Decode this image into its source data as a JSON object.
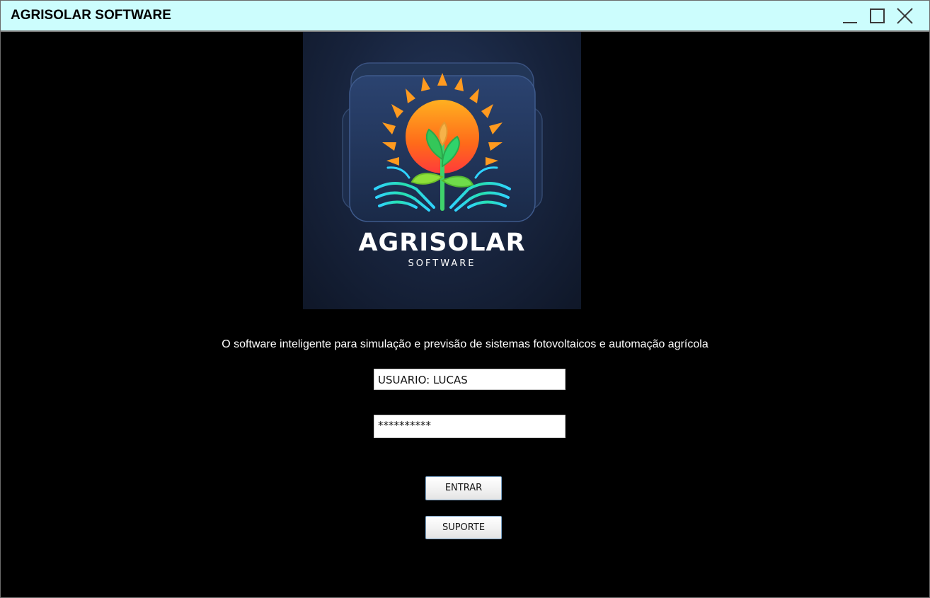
{
  "window": {
    "title": "AGRISOLAR SOFTWARE"
  },
  "logo": {
    "title": "AGRISOLAR",
    "subtitle": "SOFTWARE"
  },
  "tagline": "O software inteligente para simulação e previsão de sistemas fotovoltaicos e automação agrícola",
  "login": {
    "username_value": "USUARIO: LUCAS",
    "password_value": "**********",
    "enter_label": "ENTRAR",
    "support_label": "SUPORTE"
  },
  "colors": {
    "titlebar": "#ccfdfd",
    "background": "#000000",
    "button_border": "#7aa3c8"
  },
  "icons": [
    "minimize-icon",
    "maximize-icon",
    "close-icon",
    "sun-plant-logo-icon"
  ]
}
